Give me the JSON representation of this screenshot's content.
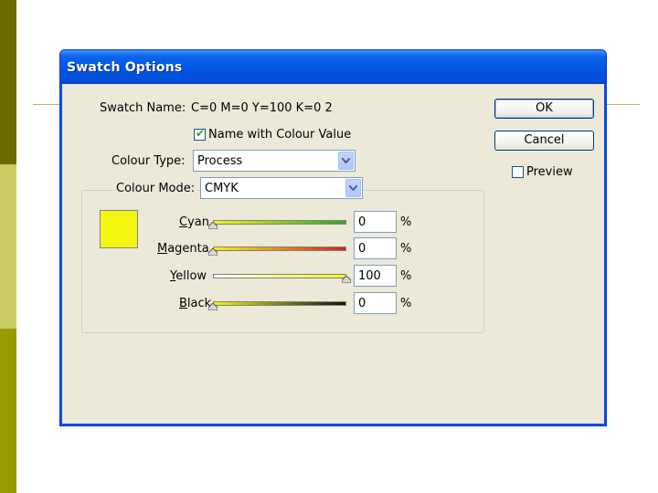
{
  "dialog": {
    "title": "Swatch Options",
    "swatch_name_label": "Swatch Name:",
    "swatch_name_value": "C=0 M=0 Y=100 K=0 2",
    "name_with_colour_value_label": "Name with Colour Value",
    "name_with_colour_value_checked": true,
    "colour_type_label": "Colour Type:",
    "colour_type_value": "Process",
    "colour_mode_label": "Colour Mode:",
    "colour_mode_value": "CMYK",
    "swatch_color": "#f5f512",
    "sliders": [
      {
        "label": "Cyan",
        "value": "0",
        "unit": "%",
        "level": 0
      },
      {
        "label": "Magenta",
        "value": "0",
        "unit": "%",
        "level": 0
      },
      {
        "label": "Yellow",
        "value": "100",
        "unit": "%",
        "level": 1.0
      },
      {
        "label": "Black",
        "value": "0",
        "unit": "%",
        "level": 0
      }
    ],
    "ok_label": "OK",
    "cancel_label": "Cancel",
    "preview_label": "Preview",
    "preview_checked": false
  }
}
